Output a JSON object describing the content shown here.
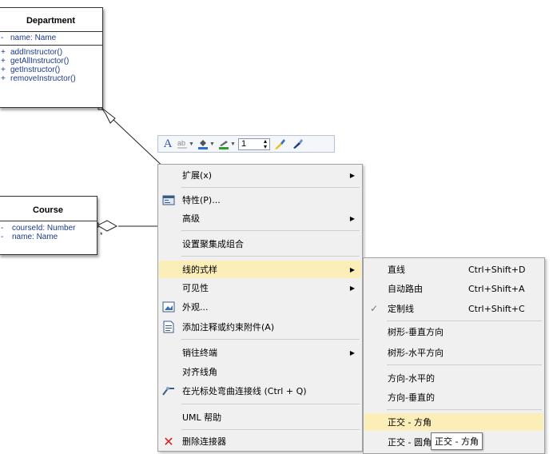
{
  "diagram": {
    "department": {
      "name": "Department",
      "attributes": [
        {
          "vis": "-",
          "text": "name: Name"
        }
      ],
      "operations": [
        {
          "vis": "+",
          "text": "addInstructor()"
        },
        {
          "vis": "+",
          "text": "getAllInstructor()"
        },
        {
          "vis": "+",
          "text": "getInstructor()"
        },
        {
          "vis": "+",
          "text": "removeInstructor()"
        }
      ]
    },
    "course": {
      "name": "Course",
      "attributes": [
        {
          "vis": "-",
          "text": "courseId: Number"
        },
        {
          "vis": "-",
          "text": "name: Name"
        }
      ]
    },
    "multiplicity": "*"
  },
  "toolbar": {
    "line_width": "1"
  },
  "context_menu": {
    "items": [
      {
        "label": "扩展(x)",
        "submenu": true
      },
      {
        "label": "特性(P)...",
        "icon": "properties-icon"
      },
      {
        "label": "高级",
        "submenu": true
      },
      {
        "label": "设置聚集成组合"
      },
      {
        "label": "线的式样",
        "submenu": true,
        "highlighted": true
      },
      {
        "label": "可见性",
        "submenu": true
      },
      {
        "label": "外观...",
        "icon": "appearance-icon"
      },
      {
        "label": "添加注释或约束附件(A)",
        "icon": "note-icon"
      },
      {
        "label": "销往终端",
        "submenu": true
      },
      {
        "label": "对齐线角"
      },
      {
        "label": "在光标处弯曲连接线 (Ctrl + Q)",
        "icon": "bend-line-icon"
      },
      {
        "label": "UML 帮助"
      },
      {
        "label": "删除连接器",
        "icon": "delete-icon"
      }
    ]
  },
  "line_style_submenu": {
    "items": [
      {
        "label": "直线",
        "shortcut": "Ctrl+Shift+D"
      },
      {
        "label": "自动路由",
        "shortcut": "Ctrl+Shift+A"
      },
      {
        "label": "定制线",
        "shortcut": "Ctrl+Shift+C",
        "checked": true
      },
      {
        "label": "树形-垂直方向"
      },
      {
        "label": "树形-水平方向"
      },
      {
        "label": "方向-水平的"
      },
      {
        "label": "方向-垂直的"
      },
      {
        "label": "正交 - 方角",
        "highlighted": true
      },
      {
        "label": "正交 - 圆角"
      }
    ]
  },
  "tooltip": {
    "text": "正交 - 方角"
  },
  "colors": {
    "highlight": "#fbeeb8",
    "menu_bg": "#f0f0f0",
    "uml_text": "#1a3a8a",
    "delete_red": "#d42020"
  }
}
